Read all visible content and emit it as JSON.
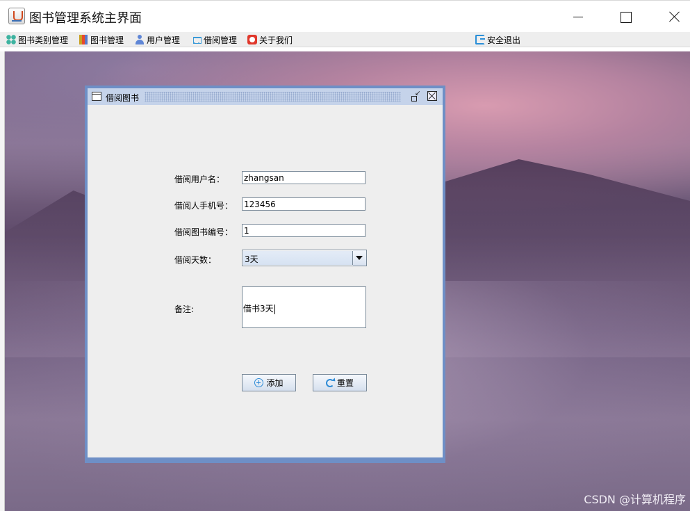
{
  "window": {
    "title": "图书管理系统主界面"
  },
  "menubar": {
    "items": [
      {
        "label": "图书类别管理",
        "icon": "grid-icon"
      },
      {
        "label": "图书管理",
        "icon": "books-icon"
      },
      {
        "label": "用户管理",
        "icon": "user-icon"
      },
      {
        "label": "借阅管理",
        "icon": "cart-icon"
      },
      {
        "label": "关于我们",
        "icon": "about-icon"
      }
    ],
    "exit": {
      "label": "安全退出",
      "icon": "exit-icon"
    }
  },
  "borrow_frame": {
    "title": "借阅图书",
    "fields": {
      "username": {
        "label": "借阅用户名：",
        "value": "zhangsan"
      },
      "phone": {
        "label": "借阅人手机号：",
        "value": "123456"
      },
      "book_id": {
        "label": "借阅图书编号：",
        "value": "1"
      },
      "days": {
        "label": "借阅天数：",
        "value": "3天"
      },
      "remark": {
        "label": "备注:",
        "value": "借书3天"
      }
    },
    "buttons": {
      "add": "添加",
      "reset": "重置"
    }
  },
  "watermark": "CSDN @计算机程序",
  "colors": {
    "frame_border": "#6e8fc6",
    "frame_title_bg": "#c5d3ea",
    "panel_bg": "#eeeeee",
    "accent_icon": "#2d8bd6"
  }
}
